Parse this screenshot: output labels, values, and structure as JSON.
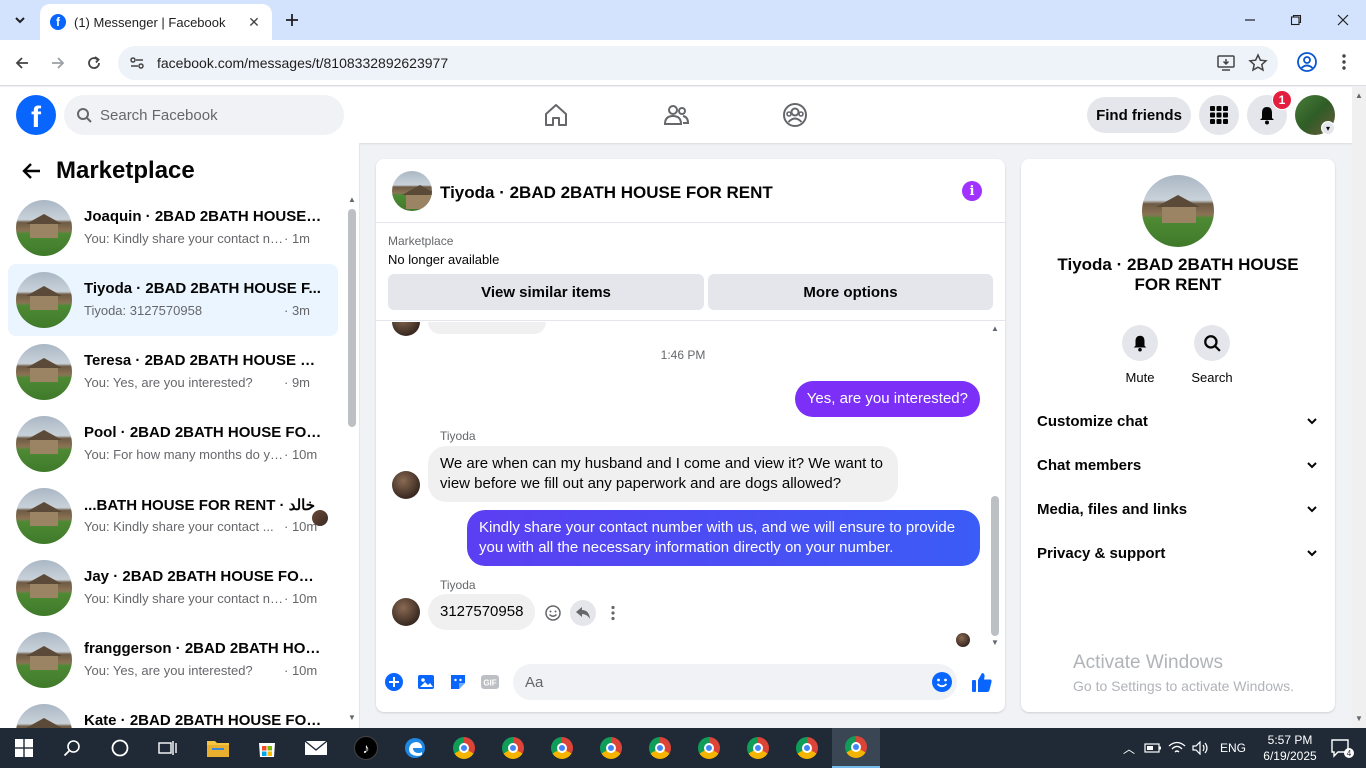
{
  "browser": {
    "tab_title": "(1) Messenger | Facebook",
    "url": "facebook.com/messages/t/8108332892623977"
  },
  "fb_header": {
    "logo_letter": "f",
    "search_placeholder": "Search Facebook",
    "find_friends": "Find friends",
    "notification_count": "1"
  },
  "left_panel": {
    "title": "Marketplace",
    "conversations": [
      {
        "name": "Joaquin · 2BAD 2BATH HOUSE F...",
        "snippet": "You: Kindly share your contact nu...",
        "time": "· 1m",
        "active": false
      },
      {
        "name": "Tiyoda · 2BAD 2BATH HOUSE F...",
        "snippet": "Tiyoda: 3127570958",
        "time": "· 3m",
        "active": true
      },
      {
        "name": "Teresa · 2BAD 2BATH HOUSE FO...",
        "snippet": "You: Yes, are you interested?",
        "time": "· 9m",
        "active": false
      },
      {
        "name": "Pool · 2BAD 2BATH HOUSE FOR ...",
        "snippet": "You: For how many months do yo...",
        "time": "· 10m",
        "active": false
      },
      {
        "name": "...BATH HOUSE FOR RENT · خالد",
        "snippet": "You: Kindly share your contact ...",
        "time": "· 10m",
        "active": false
      },
      {
        "name": "Jay · 2BAD 2BATH HOUSE FOR R...",
        "snippet": "You: Kindly share your contact nu...",
        "time": "· 10m",
        "active": false
      },
      {
        "name": "franggerson · 2BAD 2BATH HOU...",
        "snippet": "You: Yes, are you interested?",
        "time": "· 10m",
        "active": false
      },
      {
        "name": "Kate · 2BAD 2BATH HOUSE FOR ...",
        "snippet": "",
        "time": "",
        "active": false
      }
    ]
  },
  "chat": {
    "title": "Tiyoda · 2BAD 2BATH HOUSE FOR RENT",
    "marketplace_label": "Marketplace",
    "listing_status": "No longer available",
    "view_similar": "View similar items",
    "more_options": "More options",
    "timestamp": "1:46 PM",
    "msg_out_1": "Yes, are you interested?",
    "sender_1": "Tiyoda",
    "msg_in_1": "We are when can my husband and I come and view it? We want to view before we fill out any paperwork and are dogs allowed?",
    "msg_out_2": "Kindly share your contact number with us, and we will ensure to provide you with all the necessary information directly on your number.",
    "sender_2": "Tiyoda",
    "msg_in_2": "3127570958",
    "composer_placeholder": "Aa"
  },
  "right_panel": {
    "name": "Tiyoda · 2BAD 2BATH HOUSE FOR RENT",
    "mute_label": "Mute",
    "search_label": "Search",
    "sections": [
      "Customize chat",
      "Chat members",
      "Media, files and links",
      "Privacy & support"
    ]
  },
  "watermark": {
    "line1": "Activate Windows",
    "line2": "Go to Settings to activate Windows."
  },
  "taskbar": {
    "language": "ENG",
    "time": "5:57 PM",
    "date": "6/19/2025",
    "notification_count": "4"
  },
  "colors": {
    "fb_blue": "#0866ff",
    "outgoing_bubble": "#7b2ff7",
    "outgoing_bubble_blue": "#3b5cf6",
    "active_conversation": "#ebf5ff"
  }
}
